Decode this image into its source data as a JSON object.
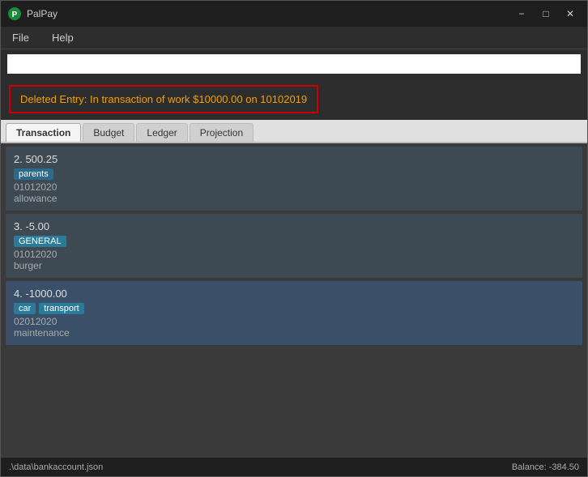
{
  "titleBar": {
    "title": "PalPay",
    "iconColor": "#00aacc",
    "minimizeBtn": "−",
    "maximizeBtn": "□",
    "closeBtn": "✕"
  },
  "menuBar": {
    "items": [
      "File",
      "Help"
    ]
  },
  "searchBar": {
    "placeholder": "",
    "value": ""
  },
  "alert": {
    "message": "Deleted Entry: In transaction of work $10000.00 on 10102019"
  },
  "tabs": [
    {
      "label": "Transaction",
      "active": true
    },
    {
      "label": "Budget",
      "active": false
    },
    {
      "label": "Ledger",
      "active": false
    },
    {
      "label": "Projection",
      "active": false
    }
  ],
  "transactions": [
    {
      "id": 2,
      "amount": "500.25",
      "tags": [
        "parents"
      ],
      "date": "01012020",
      "description": "allowance",
      "highlighted": false
    },
    {
      "id": 3,
      "amount": "-5.00",
      "tags": [
        "GENERAL"
      ],
      "date": "01012020",
      "description": "burger",
      "highlighted": false
    },
    {
      "id": 4,
      "amount": "-1000.00",
      "tags": [
        "car",
        "transport"
      ],
      "date": "02012020",
      "description": "maintenance",
      "highlighted": true
    }
  ],
  "statusBar": {
    "file": ".\\data\\bankaccount.json",
    "balance": "Balance: -384.50"
  }
}
